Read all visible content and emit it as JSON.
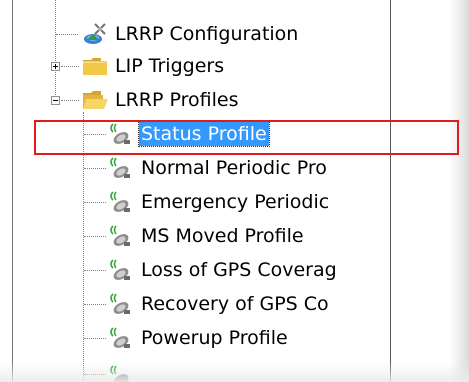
{
  "tree": {
    "items": [
      {
        "label": "LRRP Configuration",
        "icon": "lrrp-config-icon",
        "level": 1,
        "expander": "none"
      },
      {
        "label": "LIP Triggers",
        "icon": "folder-icon",
        "level": 1,
        "expander": "plus"
      },
      {
        "label": "LRRP Profiles",
        "icon": "folder-open-icon",
        "level": 1,
        "expander": "minus"
      },
      {
        "label": "Status Profile",
        "icon": "satellite-icon",
        "level": 2,
        "selected": true
      },
      {
        "label": "Normal Periodic Pro",
        "icon": "satellite-icon",
        "level": 2
      },
      {
        "label": "Emergency Periodic",
        "icon": "satellite-icon",
        "level": 2
      },
      {
        "label": "MS Moved Profile",
        "icon": "satellite-icon",
        "level": 2
      },
      {
        "label": "Loss of GPS Coverag",
        "icon": "satellite-icon",
        "level": 2
      },
      {
        "label": "Recovery of GPS Co",
        "icon": "satellite-icon",
        "level": 2
      },
      {
        "label": "Powerup Profile",
        "icon": "satellite-icon",
        "level": 2
      }
    ]
  },
  "colors": {
    "selection": "#3399ff",
    "highlight": "#e01b1b",
    "folder": "#f2c84b",
    "tree_line": "#808080"
  }
}
